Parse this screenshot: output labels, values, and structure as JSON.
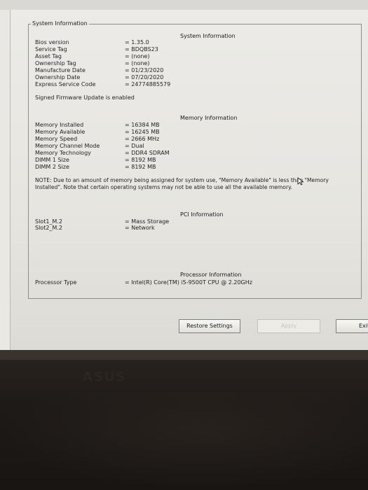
{
  "window": {
    "title": "System Information"
  },
  "system": {
    "heading": "System Information",
    "rows": [
      {
        "label": "Bios version",
        "value": "= 1.35.0"
      },
      {
        "label": "Service Tag",
        "value": "= BDQBS23"
      },
      {
        "label": "Asset Tag",
        "value": "= (none)"
      },
      {
        "label": "Ownership Tag",
        "value": "= (none)"
      },
      {
        "label": "Manufacture Date",
        "value": "= 01/23/2020"
      },
      {
        "label": "Ownership Date",
        "value": "= 07/20/2020"
      },
      {
        "label": "Express Service Code",
        "value": "= 24774885579"
      }
    ],
    "firmware_note": "Signed Firmware Update is enabled"
  },
  "memory": {
    "heading": "Memory Information",
    "rows": [
      {
        "label": "Memory Installed",
        "value": "= 16384 MB"
      },
      {
        "label": "Memory Available",
        "value": "= 16245 MB"
      },
      {
        "label": "Memory Speed",
        "value": "= 2666 MHz"
      },
      {
        "label": "Memory Channel Mode",
        "value": "= Dual"
      },
      {
        "label": "Memory Technology",
        "value": "= DDR4 SDRAM"
      },
      {
        "label": "DIMM 1 Size",
        "value": "= 8192 MB"
      },
      {
        "label": "DIMM 2 Size",
        "value": "= 8192 MB"
      }
    ],
    "note": "NOTE: Due to an amount of memory being assigned for system use, \"Memory Available\" is less than \"Memory Installed\". Note that certain operating systems may not be able to use all the available memory."
  },
  "pci": {
    "heading": "PCI Information",
    "rows": [
      {
        "label": "Slot1_M.2",
        "value": "= Mass Storage"
      },
      {
        "label": "Slot2_M.2",
        "value": "= Network"
      }
    ]
  },
  "processor": {
    "heading": "Processor Information",
    "rows": [
      {
        "label": "Processor Type",
        "value": "= Intel(R) Core(TM) i5-9500T CPU @ 2.20GHz"
      }
    ]
  },
  "buttons": {
    "restore": "Restore Settings",
    "apply": "Apply",
    "exit": "Exit"
  },
  "bezel": {
    "brand": "ASUS"
  }
}
